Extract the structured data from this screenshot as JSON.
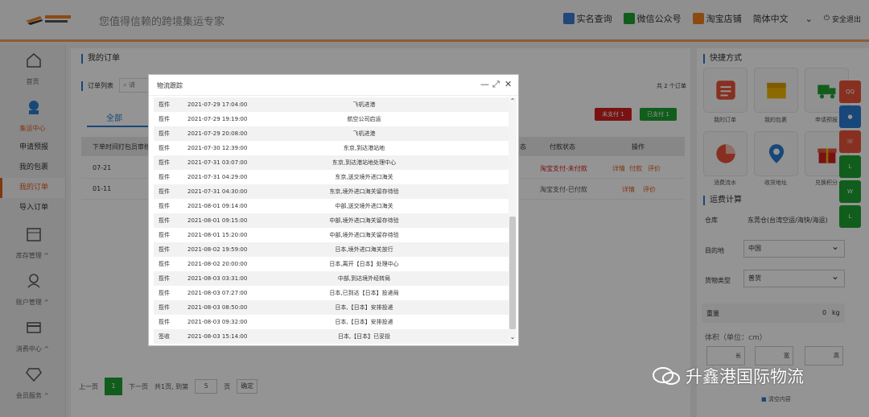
{
  "header": {
    "slogan": "您值得信赖的跨境集运专家",
    "nav": [
      {
        "label": "实名查询",
        "icon": "id-card-icon",
        "color": "#3a7bd5"
      },
      {
        "label": "微信公众号",
        "icon": "wechat-icon",
        "color": "#1ea030"
      },
      {
        "label": "淘宝店铺",
        "icon": "taobao-icon",
        "color": "#f08020"
      }
    ],
    "language": "简体中文",
    "logout": "安全退出"
  },
  "sidebar": {
    "home": "首页",
    "jiyun": "集运中心",
    "jiyun_items": [
      "申请预报",
      "我的包裹",
      "我的订单",
      "导入订单"
    ],
    "active_item": "我的订单",
    "inventory": "库存管理",
    "account": "账户管理",
    "consumption": "消费中心",
    "member": "会员服务"
  },
  "main": {
    "title": "我的订单",
    "list_label": "订单列表",
    "search_placeholder": "请",
    "count_text": "共 2 个订单",
    "tab_all": "全部",
    "btn_unpaid": "未支付 1",
    "btn_paid": "已支付 1",
    "columns": [
      "下单时间",
      "打包员审核",
      "态",
      "付款状态",
      "操作"
    ],
    "rows": [
      {
        "date": "07-21",
        "pay": "淘宝支付-未付款",
        "ops": [
          "详情",
          "付款",
          "评价"
        ],
        "pay_color": "#d02020"
      },
      {
        "date": "01-11",
        "pay": "淘宝支付-已付款",
        "ops": [
          "详情",
          "评价"
        ],
        "pay_color": "#555555"
      }
    ],
    "pager": {
      "prev": "上一页",
      "page": "1",
      "next": "下一页",
      "info": "共1页, 到第",
      "goto": "5",
      "unit": "页",
      "confirm": "确定"
    }
  },
  "quick": {
    "title": "快捷方式",
    "items": [
      {
        "label": "我的订单",
        "color": "#e8533a"
      },
      {
        "label": "我的包裹",
        "color": "#f2b705"
      },
      {
        "label": "申请预报",
        "color": "#1ea030"
      },
      {
        "label": "消费流水",
        "color": "#e8533a"
      },
      {
        "label": "收货地址",
        "color": "#2a7ad0"
      },
      {
        "label": "兑换积分",
        "color": "#d02020"
      }
    ]
  },
  "freight": {
    "title": "运费计算",
    "warehouse_label": "仓库",
    "warehouse_value": "东莞仓(台湾空运/海快/海运)",
    "dest_label": "目的地",
    "dest_value": "中国",
    "type_label": "货物类型",
    "type_value": "普货",
    "weight_label": "重量",
    "weight_value": "0",
    "weight_unit": "kg",
    "volume_label": "体积（单位：cm）",
    "length": "长",
    "width": "宽",
    "height": "高",
    "clear": "清空内容"
  },
  "modal": {
    "title": "物流跟踪",
    "rows": [
      {
        "type": "揽件",
        "time": "2021-07-29 17:04:00",
        "desc": "飞机进港"
      },
      {
        "type": "揽件",
        "time": "2021-07-29 19:19:00",
        "desc": "航空公司启运"
      },
      {
        "type": "揽件",
        "time": "2021-07-29 20:08:00",
        "desc": "飞机进港"
      },
      {
        "type": "揽件",
        "time": "2021-07-30 12:39:00",
        "desc": "东京,到达港站地"
      },
      {
        "type": "揽件",
        "time": "2021-07-31 03:07:00",
        "desc": "东京,到达港站地处理中心"
      },
      {
        "type": "揽件",
        "time": "2021-07-31 04:29:00",
        "desc": "东京,送交境外进口海关"
      },
      {
        "type": "揽件",
        "time": "2021-07-31 04:30:00",
        "desc": "东京,境外进口海关留存待验"
      },
      {
        "type": "揽件",
        "time": "2021-08-01 09:14:00",
        "desc": "中部,送交境外进口海关"
      },
      {
        "type": "揽件",
        "time": "2021-08-01 09:15:00",
        "desc": "中部,境外进口海关留存待验"
      },
      {
        "type": "揽件",
        "time": "2021-08-01 15:20:00",
        "desc": "中部,境外进口海关留存待验"
      },
      {
        "type": "揽件",
        "time": "2021-08-02 19:59:00",
        "desc": "日本,境外进口海关放行"
      },
      {
        "type": "揽件",
        "time": "2021-08-02 20:00:00",
        "desc": "日本,离开【日本】处理中心"
      },
      {
        "type": "揽件",
        "time": "2021-08-03 03:31:00",
        "desc": "中部,到达境外经转局"
      },
      {
        "type": "揽件",
        "time": "2021-08-03 07:27:00",
        "desc": "日本,已到达【日本】投递局"
      },
      {
        "type": "揽件",
        "time": "2021-08-03 08:50:00",
        "desc": "日本,【日本】安排投递"
      },
      {
        "type": "揽件",
        "time": "2021-08-03 09:32:00",
        "desc": "日本,【日本】安排投递"
      },
      {
        "type": "签收",
        "time": "2021-08-03 15:14:00",
        "desc": "日本,【日本】已妥投"
      }
    ]
  },
  "watermark": "升鑫港国际物流"
}
